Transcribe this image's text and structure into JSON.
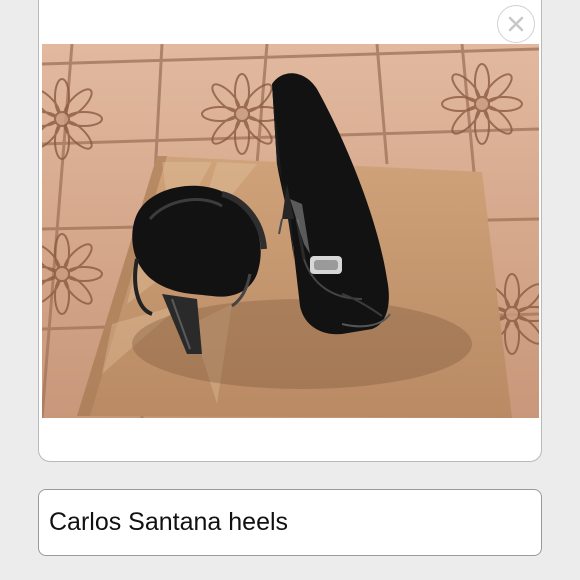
{
  "photo": {
    "subject": "black patent leather peep-toe heels on a cardboard shoe box lid over a tiled floor with flower pattern",
    "close_icon": "close-icon"
  },
  "caption": {
    "value": "Carlos Santana heels"
  },
  "colors": {
    "page_background": "#ececec",
    "card_background": "#ffffff",
    "card_border": "#b9b9b9",
    "caption_border": "#9a9a9a",
    "close_glyph": "#c8c8c8",
    "floor_tile": "#d9a98c",
    "box_cardboard": "#c59870",
    "shoe_black": "#111111"
  }
}
